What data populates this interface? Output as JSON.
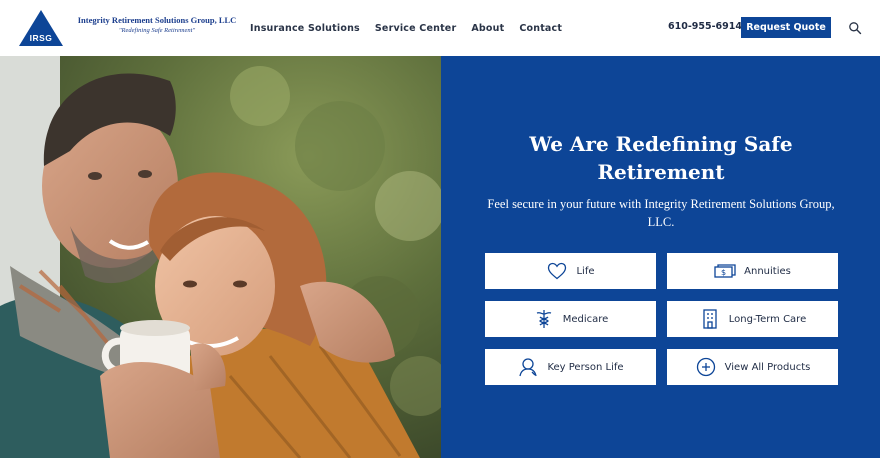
{
  "colors": {
    "brand_blue": "#0d4597",
    "text_dark": "#1f2b44",
    "white": "#ffffff"
  },
  "header": {
    "logo": {
      "mark_text": "IRSG",
      "name": "Integrity Retirement Solutions Group, LLC",
      "tagline": "\"Redefining Safe Retirement\""
    },
    "nav": [
      {
        "label": "Insurance Solutions"
      },
      {
        "label": "Service Center"
      },
      {
        "label": "About"
      },
      {
        "label": "Contact"
      }
    ],
    "phone": "610-955-6914",
    "cta_label": "Request Quote",
    "search_icon": "search-icon"
  },
  "hero": {
    "image": "couple-embracing-with-coffee-mug",
    "title": "We Are Redefining Safe Retirement",
    "subtitle": "Feel secure in your future with Integrity Retirement Solutions Group, LLC.",
    "products": [
      {
        "label": "Life",
        "icon": "heart-icon"
      },
      {
        "label": "Annuities",
        "icon": "money-icon"
      },
      {
        "label": "Medicare",
        "icon": "caduceus-icon"
      },
      {
        "label": "Long-Term Care",
        "icon": "building-icon"
      },
      {
        "label": "Key Person Life",
        "icon": "person-icon"
      },
      {
        "label": "View All Products",
        "icon": "plus-circle-icon"
      }
    ]
  }
}
